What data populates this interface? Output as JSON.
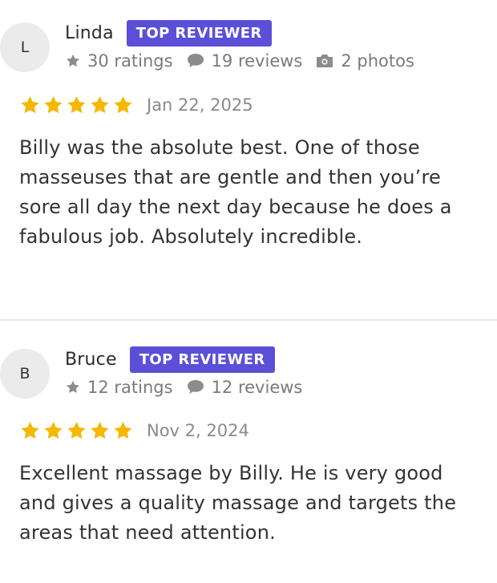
{
  "reviews": [
    {
      "avatar_letter": "L",
      "name": "Linda",
      "badge": "TOP REVIEWER",
      "stats": {
        "ratings": "30 ratings",
        "reviews": "19 reviews",
        "photos": "2 photos"
      },
      "rating_stars": 5,
      "date": "Jan 22, 2025",
      "text": "Billy was the absolute best. One of those masseuses that are gentle and then you’re sore all day the next day because he does a fabulous job. Absolutely incredible."
    },
    {
      "avatar_letter": "B",
      "name": "Bruce",
      "badge": "TOP REVIEWER",
      "stats": {
        "ratings": "12 ratings",
        "reviews": "12 reviews"
      },
      "rating_stars": 5,
      "date": "Nov 2, 2024",
      "text": "Excellent massage by Billy. He is very good and gives a quality massage and targets the areas that need attention."
    }
  ],
  "colors": {
    "badge_bg": "#5b4fd8",
    "star": "#f5b700",
    "stat_icon": "#8c8c8c"
  },
  "icons": {
    "rating_stat": "star-icon",
    "review_stat": "speech-bubble-icon",
    "photo_stat": "camera-icon",
    "rating_star": "filled-star-icon"
  }
}
